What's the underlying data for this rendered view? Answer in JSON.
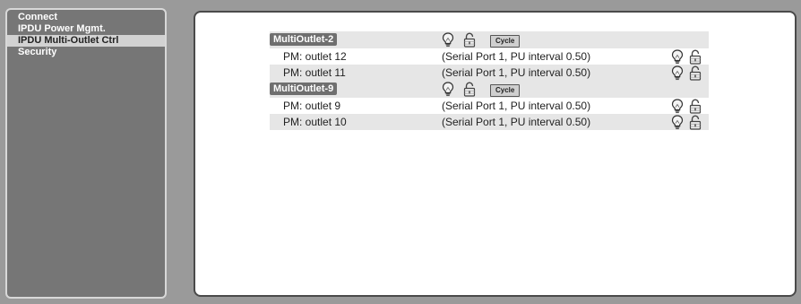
{
  "sidebar": {
    "items": [
      {
        "label": "Connect"
      },
      {
        "label": "IPDU Power Mgmt."
      },
      {
        "label": "IPDU Multi-Outlet Ctrl"
      },
      {
        "label": "Security"
      }
    ],
    "active": "IPDU Multi-Outlet Ctrl"
  },
  "groups": [
    {
      "name": "MultiOutlet-2",
      "cycle_label": "Cycle",
      "outlets": [
        {
          "name": "PM: outlet 12",
          "desc": "(Serial Port 1, PU interval 0.50)"
        },
        {
          "name": "PM: outlet 11",
          "desc": "(Serial Port 1, PU interval 0.50)"
        }
      ]
    },
    {
      "name": "MultiOutlet-9",
      "cycle_label": "Cycle",
      "outlets": [
        {
          "name": "PM: outlet 9",
          "desc": "(Serial Port 1, PU interval 0.50)"
        },
        {
          "name": "PM: outlet 10",
          "desc": "(Serial Port 1, PU interval 0.50)"
        }
      ]
    }
  ],
  "icons": {
    "power": "lightbulb-icon",
    "lock": "padlock-icon"
  },
  "colors": {
    "sidebar_bg": "#767676",
    "sidebar_active": "#d2d2d2",
    "group_label_bg": "#6f6f6f",
    "row_shade": "#e6e6e6"
  }
}
